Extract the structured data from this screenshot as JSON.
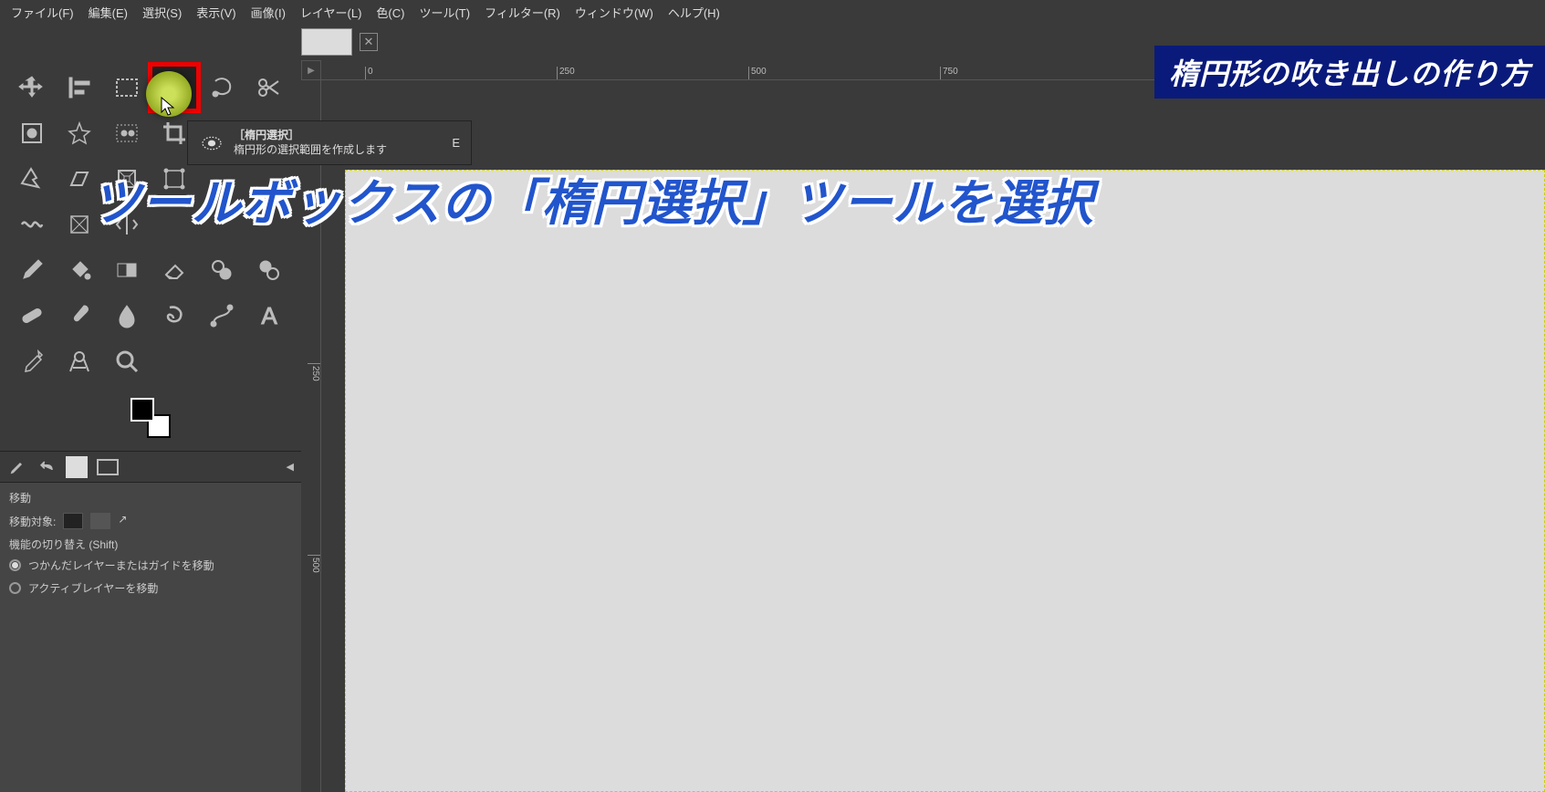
{
  "menu": [
    "ファイル(F)",
    "編集(E)",
    "選択(S)",
    "表示(V)",
    "画像(I)",
    "レイヤー(L)",
    "色(C)",
    "ツール(T)",
    "フィルター(R)",
    "ウィンドウ(W)",
    "ヘルプ(H)"
  ],
  "tooltip": {
    "title": "［楕円選択］",
    "desc": "楕円形の選択範囲を作成します",
    "key": "E"
  },
  "ruler_h": [
    "0",
    "250",
    "500",
    "750"
  ],
  "ruler_v": [
    "250",
    "500"
  ],
  "options": {
    "title": "移動",
    "target_label": "移動対象:",
    "toggle_label": "機能の切り替え (Shift)",
    "radio1": "つかんだレイヤーまたはガイドを移動",
    "radio2": "アクティブレイヤーを移動"
  },
  "banner": "楕円形の吹き出しの作り方",
  "instruction": "ツールボックスの「楕円選択」ツールを選択",
  "tool_names": [
    "move-tool",
    "align-tool",
    "rect-select-tool",
    "ellipse-select-tool",
    "lasso-tool",
    "scissors-tool",
    "foreground-select-tool",
    "fuzzy-select-tool",
    "by-color-select-tool",
    "crop-tool",
    "ellipse-overlay",
    "",
    "transform-tool",
    "shear-tool",
    "perspective-tool",
    "cage-tool",
    "",
    "",
    "warp-tool",
    "handle-tool",
    "flip-tool",
    "",
    "",
    "",
    "ink-tool",
    "bucket-tool",
    "gradient-tool",
    "eraser-tool",
    "clone-tool",
    "heal-tool",
    "bandage-tool",
    "brush-tool",
    "blur-tool",
    "smudge-tool",
    "path-tool",
    "text-tool",
    "picker-tool",
    "measure-tool",
    "zoom-tool",
    "",
    "",
    ""
  ]
}
